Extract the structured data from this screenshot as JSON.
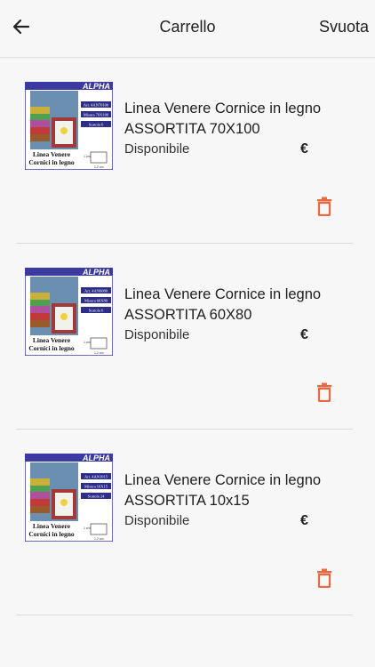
{
  "header": {
    "title": "Carrello",
    "clear_label": "Svuota"
  },
  "colors": {
    "accent": "#e8693f",
    "divider": "#d9d9d9",
    "background": "#f7f7f7"
  },
  "items": [
    {
      "name": "Linea Venere Cornice in legno ASSORTITA 70X100",
      "availability": "Disponibile",
      "price": "€",
      "image_brand": "ALPHA",
      "image_tags": [
        "Art. 4AN70100",
        "Misura 70X100",
        "Scatola 6"
      ],
      "image_caption_1": "Linea Venere",
      "image_caption_2": "Cornici in legno",
      "image_dim_1": "1 cm",
      "image_dim_2": "1,2 cm"
    },
    {
      "name": "Linea Venere Cornice in legno ASSORTITA 60X80",
      "availability": "Disponibile",
      "price": "€",
      "image_brand": "ALPHA",
      "image_tags": [
        "Art. 4AN6080",
        "Misura 60X80",
        "Scatola 6"
      ],
      "image_caption_1": "Linea Venere",
      "image_caption_2": "Cornici in legno",
      "image_dim_1": "1 cm",
      "image_dim_2": "1,2 cm"
    },
    {
      "name": "Linea Venere Cornice in legno ASSORTITA 10x15",
      "availability": "Disponibile",
      "price": "€",
      "image_brand": "ALPHA",
      "image_tags": [
        "Art. 4AN1015",
        "Misura 10X15",
        "Scatola 24"
      ],
      "image_caption_1": "Linea Venere",
      "image_caption_2": "Cornici in legno",
      "image_dim_1": "1 cm",
      "image_dim_2": "1,2 cm"
    }
  ]
}
